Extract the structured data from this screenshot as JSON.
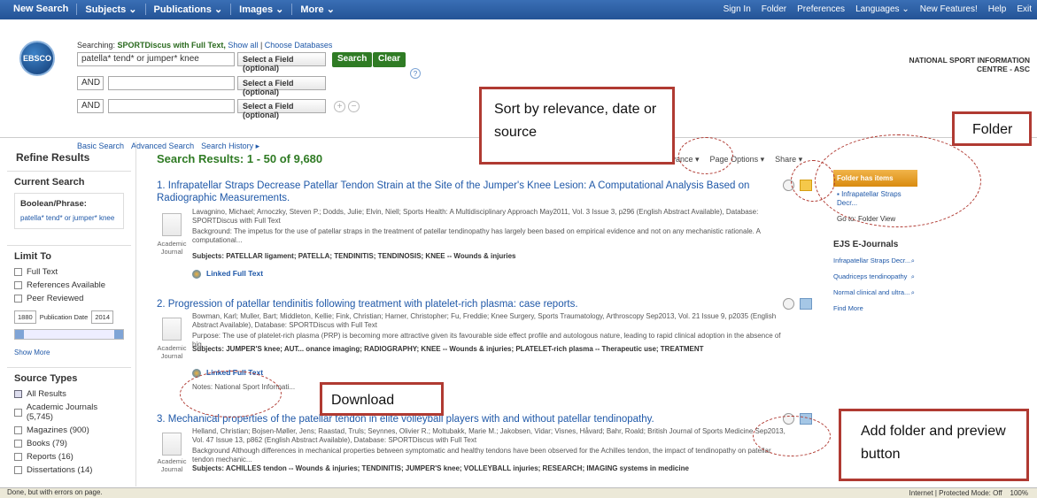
{
  "topnav": {
    "left": [
      "New Search",
      "Subjects ⌄",
      "Publications ⌄",
      "Images ⌄",
      "More ⌄"
    ],
    "right": [
      "Sign In",
      "Folder",
      "Preferences",
      "Languages ⌄",
      "New Features!",
      "Help",
      "Exit"
    ]
  },
  "search": {
    "logo_text": "EBSCO",
    "searching_label": "Searching:",
    "database": "SPORTDiscus with Full Text,",
    "show_all": "Show all",
    "choose_db": "Choose Databases",
    "query": "patella* tend* or jumper* knee",
    "field1": "Select a Field (optional)",
    "field2": "Select a Field (optional)",
    "field3": "Select a Field (optional)",
    "bool2": "AND",
    "bool3": "AND",
    "search_btn": "Search",
    "clear_btn": "Clear",
    "links": [
      "Basic Search",
      "Advanced Search",
      "Search History ▸"
    ],
    "institution": "NATIONAL SPORT INFORMATION CENTRE - ASC"
  },
  "sidebar": {
    "title": "Refine Results",
    "current_search": "Current Search",
    "boolean": "Boolean/Phrase:",
    "boolean_value": "patella* tend* or jumper* knee",
    "limit_to": "Limit To",
    "limits": [
      "Full Text",
      "References Available",
      "Peer Reviewed"
    ],
    "date_from": "1880",
    "date_label": "Publication Date",
    "date_to": "2014",
    "show_more": "Show More",
    "source_types": "Source Types",
    "sources": [
      "All Results",
      "Academic Journals (5,745)",
      "Magazines (900)",
      "Books (79)",
      "Reports (16)",
      "Dissertations (14)"
    ]
  },
  "main": {
    "results_title": "Search Results: 1 - 50 of 9,680",
    "sort": "Relevance ▾",
    "page_options": "Page Options ▾",
    "share": "Share ▾",
    "results": [
      {
        "num": "1.",
        "title": "Infrapatellar Straps Decrease Patellar Tendon Strain at the Site of the Jumper's Knee Lesion: A Computational Analysis Based on Radiographic Measurements.",
        "meta": "Lavagnino, Michael; Arnoczky, Steven P.; Dodds, Julie; Elvin, Niell; Sports Health: A Multidisciplinary Approach May2011, Vol. 3 Issue 3, p296 (English Abstract Available), Database: SPORTDiscus with Full Text",
        "abstract": "Background: The impetus for the use of patellar straps in the treatment of patellar tendinopathy has largely been based on empirical evidence and not on any mechanistic rationale. A computational...",
        "subjects": "Subjects: PATELLAR ligament; PATELLA; TENDINITIS; TENDINOSIS; KNEE -- Wounds & injuries",
        "type": "Academic Journal",
        "link": "Linked Full Text"
      },
      {
        "num": "2.",
        "title": "Progression of patellar tendinitis following treatment with platelet-rich plasma: case reports.",
        "meta": "Bowman, Karl; Muller, Bart; Middleton, Kellie; Fink, Christian; Harner, Christopher; Fu, Freddie; Knee Surgery, Sports Traumatology, Arthroscopy Sep2013, Vol. 21 Issue 9, p2035 (English Abstract Available), Database: SPORTDiscus with Full Text",
        "abstract": "Purpose: The use of platelet-rich plasma (PRP) is becoming more attractive given its favourable side effect profile and autologous nature, leading to rapid clinical adoption in the absence of hig...",
        "subjects": "Subjects: JUMPER'S knee; AUT... onance imaging; RADIOGRAPHY; KNEE -- Wounds & injuries; PLATELET-rich plasma -- Therapeutic use; TREATMENT",
        "type": "Academic Journal",
        "link": "Linked Full Text",
        "notes": "Notes: National Sport Informati..."
      },
      {
        "num": "3.",
        "title": "Mechanical properties of the patellar tendon in elite volleyball players with and without patellar tendinopathy.",
        "meta": "Helland, Christian; Bojsen-Møller, Jens; Raastad, Truls; Seynnes, Olivier R.; Moltubakk, Marie M.; Jakobsen, Vidar; Visnes, Håvard; Bahr, Roald; British Journal of Sports Medicine Sep2013, Vol. 47 Issue 13, p862 (English Abstract Available), Database: SPORTDiscus with Full Text",
        "abstract": "Background Although differences in mechanical properties between symptomatic and healthy tendons have been observed for the Achilles tendon, the impact of tendinopathy on patellar tendon mechanic...",
        "subjects": "Subjects: ACHILLES tendon -- Wounds & injuries; TENDINITIS; JUMPER'S knee; VOLLEYBALL injuries; RESEARCH; IMAGING systems in medicine",
        "type": "Academic Journal"
      }
    ]
  },
  "right": {
    "folder_head": "Folder has items",
    "folder_item": "Infrapatellar Straps Decr...",
    "go_to": "Go to: Folder View",
    "ejs": "EJS E-Journals",
    "journals": [
      "Infrapatellar Straps Decr...",
      "Quadriceps tendinopathy",
      "Normal clinical and ultra..."
    ],
    "find_more": "Find More"
  },
  "annotations": {
    "sort": "Sort by relevance, date or source",
    "folder": "Folder",
    "download": "Download",
    "add": "Add folder and preview button"
  },
  "status": {
    "left": "Done, but with errors on page.",
    "zone": "Internet | Protected Mode: Off",
    "zoom": "100%"
  }
}
